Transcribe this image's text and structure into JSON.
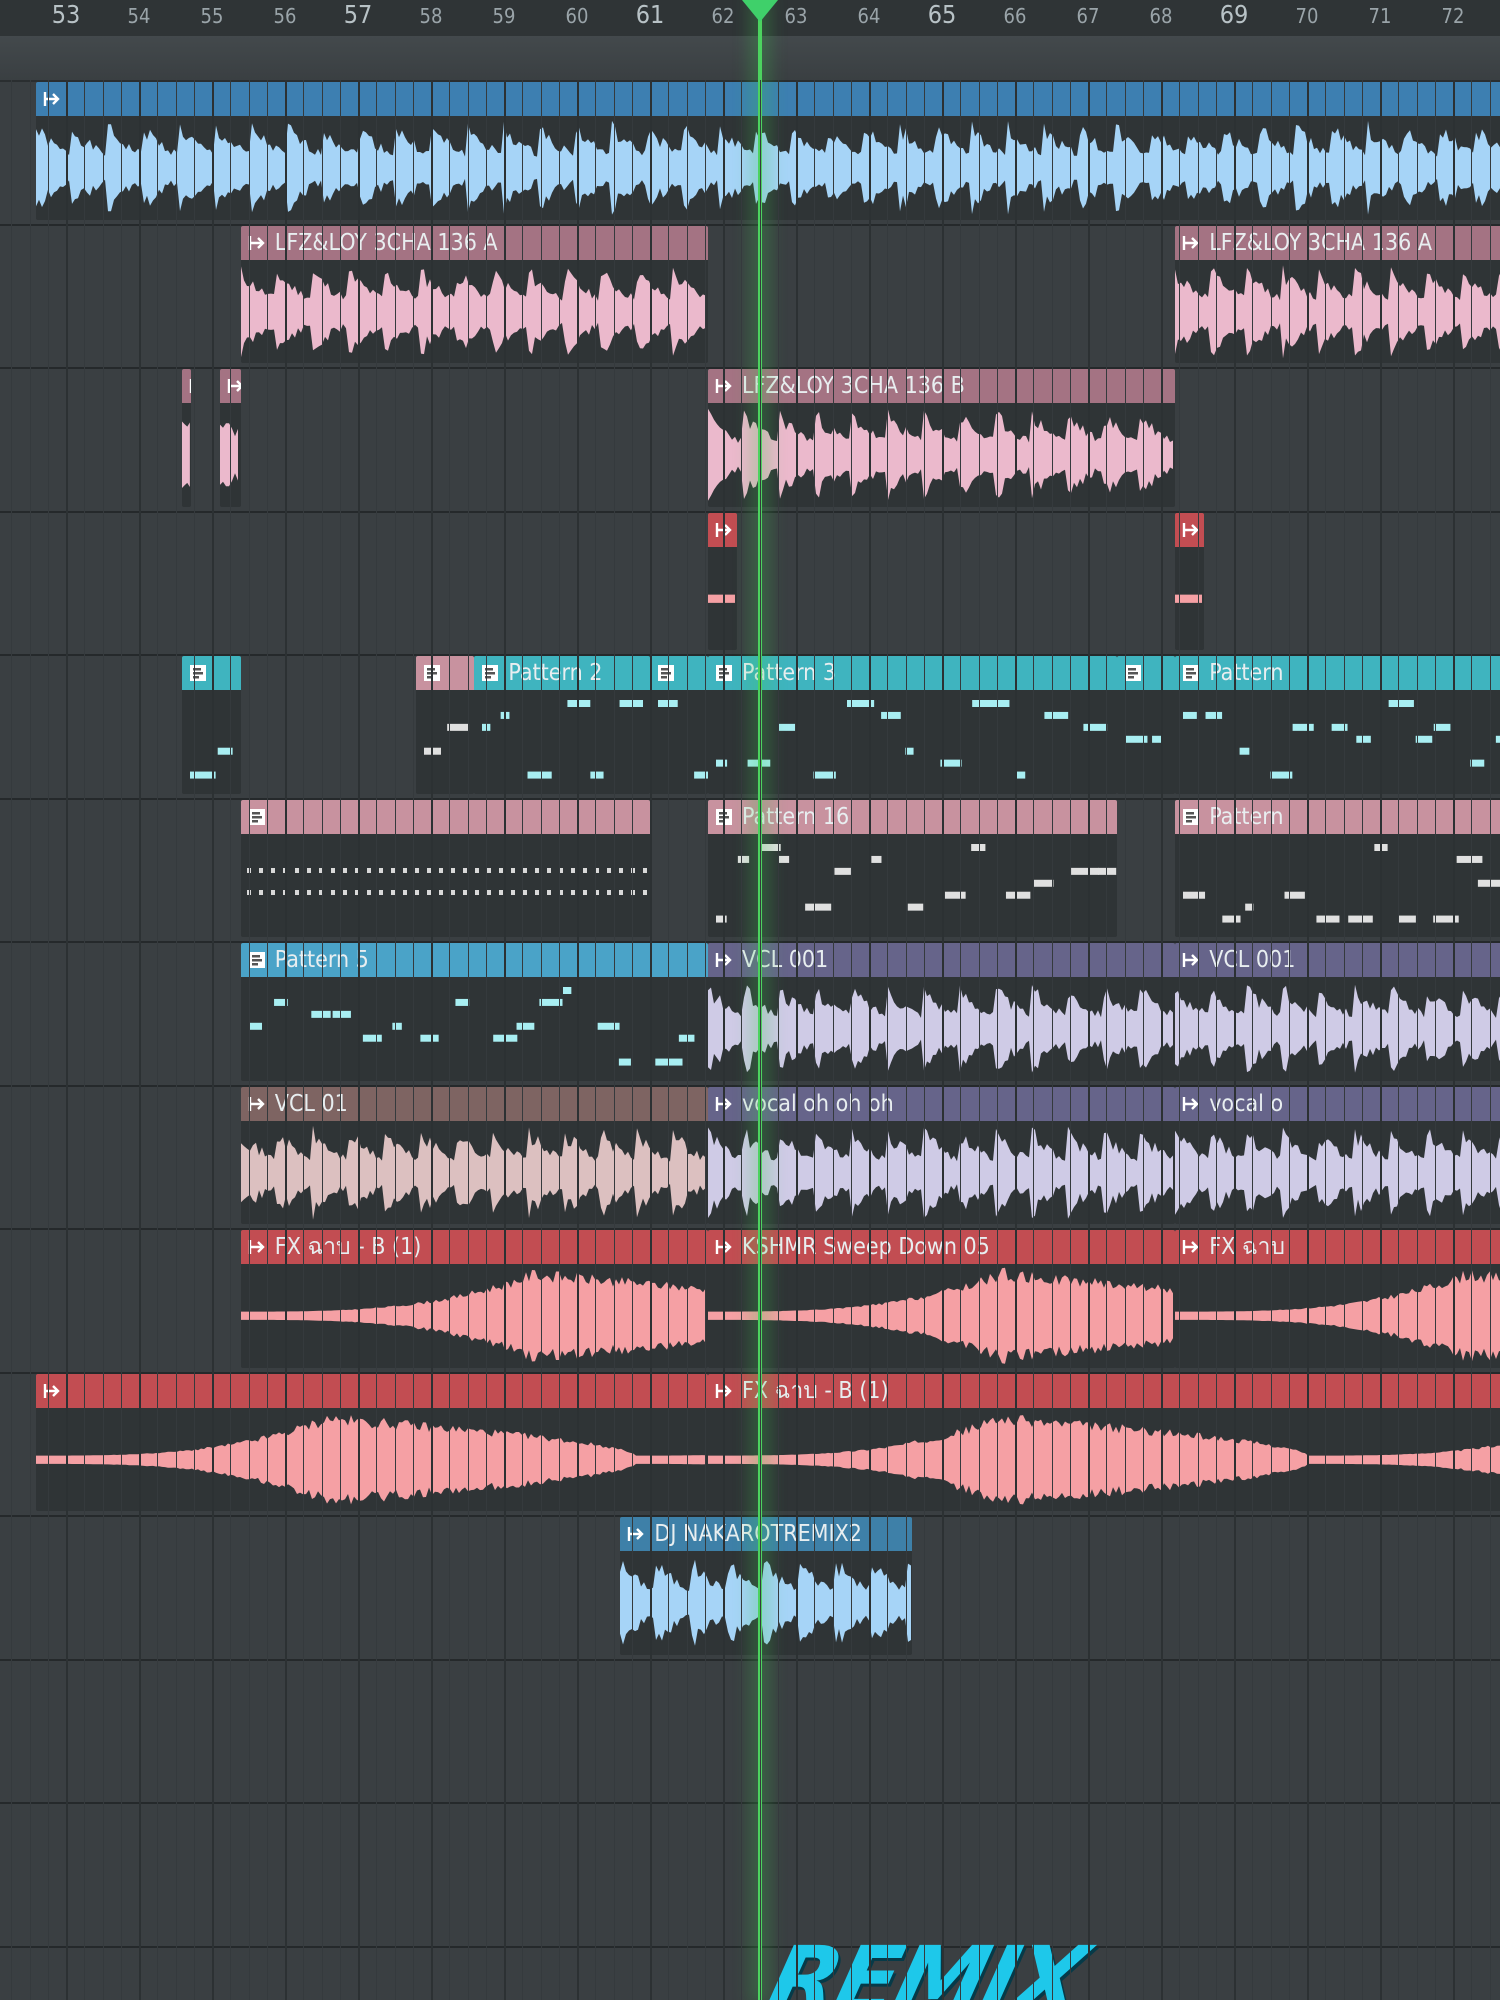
{
  "timeline": {
    "bars": [
      "53",
      "54",
      "55",
      "56",
      "57",
      "58",
      "59",
      "60",
      "61",
      "62",
      "63",
      "64",
      "65",
      "66",
      "67",
      "68",
      "69",
      "70",
      "71",
      "72"
    ],
    "major_bars": [
      "53",
      "57",
      "61",
      "65",
      "69"
    ]
  },
  "colors": {
    "pink_clip": "#b4808f",
    "teal_clip": "#3fb4bf",
    "blue_clip": "#4aa3c8",
    "slate_clip": "#6e6a88",
    "brown_clip": "#8a6c6a",
    "red_clip": "#c9504f",
    "dark_blue_clip": "#3e80a8",
    "playhead": "#4cd35f"
  },
  "tracks": [
    {
      "id": "t1",
      "clips": [
        {
          "label": "",
          "kind": "audio",
          "color": "#3d7fb1",
          "wave": "#a6d4f7",
          "start": -1.5,
          "end": 25
        }
      ]
    },
    {
      "id": "t2",
      "clips": [
        {
          "label": "LFZ&LOY 3CHA 136 A",
          "kind": "audio",
          "color": "#a47383",
          "wave": "#ebb9cc",
          "start": 2,
          "end": 10
        },
        {
          "label": "LFZ&LOY 3CHA 136 A",
          "kind": "audio",
          "color": "#a47383",
          "wave": "#ebb9cc",
          "start": 18,
          "end": 25
        }
      ]
    },
    {
      "id": "t3",
      "clips": [
        {
          "label": "",
          "kind": "audio",
          "color": "#a47383",
          "wave": "#ebb9cc",
          "start": 1,
          "end": 1.15
        },
        {
          "label": "",
          "kind": "audio",
          "color": "#a47383",
          "wave": "#ebb9cc",
          "start": 1.65,
          "end": 2
        },
        {
          "label": "LFZ&LOY 3CHA 136 B",
          "kind": "audio",
          "color": "#a47383",
          "wave": "#ebb9cc",
          "start": 10,
          "end": 18
        }
      ]
    },
    {
      "id": "t4",
      "clips": [
        {
          "label": "",
          "kind": "fx",
          "color": "#c24d52",
          "wave": "#f5a0a4",
          "start": 10,
          "end": 10.5
        },
        {
          "label": "",
          "kind": "fx",
          "color": "#c24d52",
          "wave": "#f5a0a4",
          "start": 18,
          "end": 18.5
        }
      ]
    },
    {
      "id": "t5",
      "clips": [
        {
          "label": "",
          "kind": "pattern",
          "color": "#3fb4bf",
          "start": 1,
          "end": 2
        },
        {
          "label": "",
          "kind": "pattern",
          "color": "#c8929f",
          "start": 5,
          "end": 6
        },
        {
          "label": "Pattern 2",
          "kind": "pattern",
          "color": "#3fb4bf",
          "start": 6,
          "end": 9
        },
        {
          "label": "",
          "kind": "pattern",
          "color": "#3fb4bf",
          "start": 9,
          "end": 10
        },
        {
          "label": "Pattern 3",
          "kind": "pattern",
          "color": "#3fb4bf",
          "start": 10,
          "end": 17
        },
        {
          "label": "",
          "kind": "pattern",
          "color": "#3fb4bf",
          "start": 17,
          "end": 18
        },
        {
          "label": "Pattern",
          "kind": "pattern",
          "color": "#3fb4bf",
          "start": 18,
          "end": 25
        }
      ]
    },
    {
      "id": "t6",
      "clips": [
        {
          "label": "",
          "kind": "steps",
          "color": "#c8929f",
          "start": 2,
          "end": 9
        },
        {
          "label": "Pattern 16",
          "kind": "pattern",
          "color": "#c8929f",
          "start": 10,
          "end": 17
        },
        {
          "label": "Pattern",
          "kind": "pattern",
          "color": "#c8929f",
          "start": 18,
          "end": 25
        }
      ]
    },
    {
      "id": "t7",
      "clips": [
        {
          "label": "Pattern 5",
          "kind": "pattern",
          "color": "#4aa3c8",
          "start": 2,
          "end": 10
        },
        {
          "label": "VCL 001",
          "kind": "audio",
          "color": "#66648a",
          "wave": "#cfcbe6",
          "start": 10,
          "end": 18
        },
        {
          "label": "VCL 001",
          "kind": "audio",
          "color": "#66648a",
          "wave": "#cfcbe6",
          "start": 18,
          "end": 25
        }
      ]
    },
    {
      "id": "t8",
      "clips": [
        {
          "label": "VCL 01",
          "kind": "audio",
          "color": "#7e6462",
          "wave": "#dcc0c0",
          "start": 2,
          "end": 10
        },
        {
          "label": "vocal oh oh oh",
          "kind": "audio",
          "color": "#66648a",
          "wave": "#cfcbe6",
          "start": 10,
          "end": 18
        },
        {
          "label": "vocal o",
          "kind": "audio",
          "color": "#66648a",
          "wave": "#cfcbe6",
          "start": 18,
          "end": 25
        }
      ]
    },
    {
      "id": "t9",
      "clips": [
        {
          "label": "FX ฉาบ - B (1)",
          "kind": "fx",
          "color": "#c24d52",
          "wave": "#f5a0a4",
          "start": 2,
          "end": 10
        },
        {
          "label": "KSHMR Sweep Down 05",
          "kind": "fx",
          "color": "#c24d52",
          "wave": "#f5a0a4",
          "start": 10,
          "end": 18
        },
        {
          "label": "FX ฉาบ",
          "kind": "fx",
          "color": "#c24d52",
          "wave": "#f5a0a4",
          "start": 18,
          "end": 25
        }
      ]
    },
    {
      "id": "t10",
      "clips": [
        {
          "label": "",
          "kind": "fx",
          "color": "#c24d52",
          "wave": "#f5a0a4",
          "start": -1.5,
          "end": 10
        },
        {
          "label": "FX ฉาบ - B (1)",
          "kind": "fx",
          "color": "#c24d52",
          "wave": "#f5a0a4",
          "start": 10,
          "end": 25
        }
      ]
    },
    {
      "id": "t11",
      "clips": [
        {
          "label": "DJ NAKAROTREMIX2",
          "kind": "audio",
          "color": "#3e80a8",
          "wave": "#a6d4f7",
          "start": 8.5,
          "end": 13.5
        }
      ]
    },
    {
      "id": "t12",
      "clips": []
    },
    {
      "id": "t13",
      "clips": []
    }
  ],
  "playhead_bar": "62.5",
  "logo": {
    "text": "REMIX"
  }
}
